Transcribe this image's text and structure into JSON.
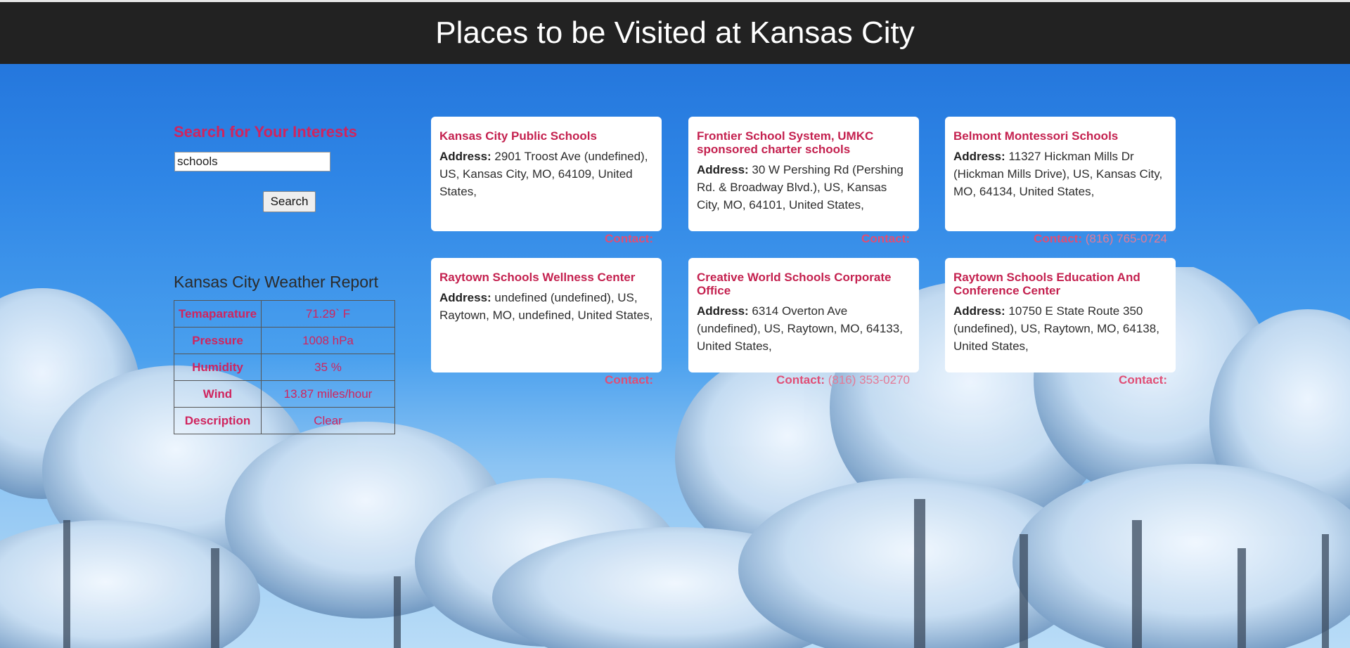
{
  "header": {
    "title": "Places to be Visited at Kansas City"
  },
  "search": {
    "title": "Search for Your Interests",
    "value": "schools",
    "button_label": "Search"
  },
  "weather": {
    "title": "Kansas City Weather Report",
    "rows": [
      {
        "label": "Temaparature",
        "value": "71.29` F"
      },
      {
        "label": "Pressure",
        "value": "1008 hPa"
      },
      {
        "label": "Humidity",
        "value": "35 %"
      },
      {
        "label": "Wind",
        "value": "13.87 miles/hour"
      },
      {
        "label": "Description",
        "value": "Clear"
      }
    ]
  },
  "places": [
    {
      "name": "Kansas City Public Schools",
      "address_label": "Address:",
      "address": "2901 Troost Ave (undefined), US, Kansas City, MO, 64109, United States,",
      "contact_label": "Contact:",
      "phone": ""
    },
    {
      "name": "Frontier School System, UMKC sponsored charter schools",
      "address_label": "Address:",
      "address": "30 W Pershing Rd (Pershing Rd. & Broadway Blvd.), US, Kansas City, MO, 64101, United States,",
      "contact_label": "Contact:",
      "phone": ""
    },
    {
      "name": "Belmont Montessori Schools",
      "address_label": "Address:",
      "address": "11327 Hickman Mills Dr (Hickman Mills Drive), US, Kansas City, MO, 64134, United States,",
      "contact_label": "Contact:",
      "phone": "(816) 765-0724"
    },
    {
      "name": "Raytown Schools Wellness Center",
      "address_label": "Address:",
      "address": "undefined (undefined), US, Raytown, MO, undefined, United States,",
      "contact_label": "Contact:",
      "phone": ""
    },
    {
      "name": "Creative World Schools Corporate Office",
      "address_label": "Address:",
      "address": "6314 Overton Ave (undefined), US, Raytown, MO, 64133, United States,",
      "contact_label": "Contact:",
      "phone": "(816) 353-0270"
    },
    {
      "name": "Raytown Schools Education And Conference Center",
      "address_label": "Address:",
      "address": "10750 E State Route 350 (undefined), US, Raytown, MO, 64138, United States,",
      "contact_label": "Contact:",
      "phone": ""
    }
  ],
  "colors": {
    "accent": "#d0245e",
    "header_bg": "#222222",
    "sky": "#2f86e6"
  }
}
